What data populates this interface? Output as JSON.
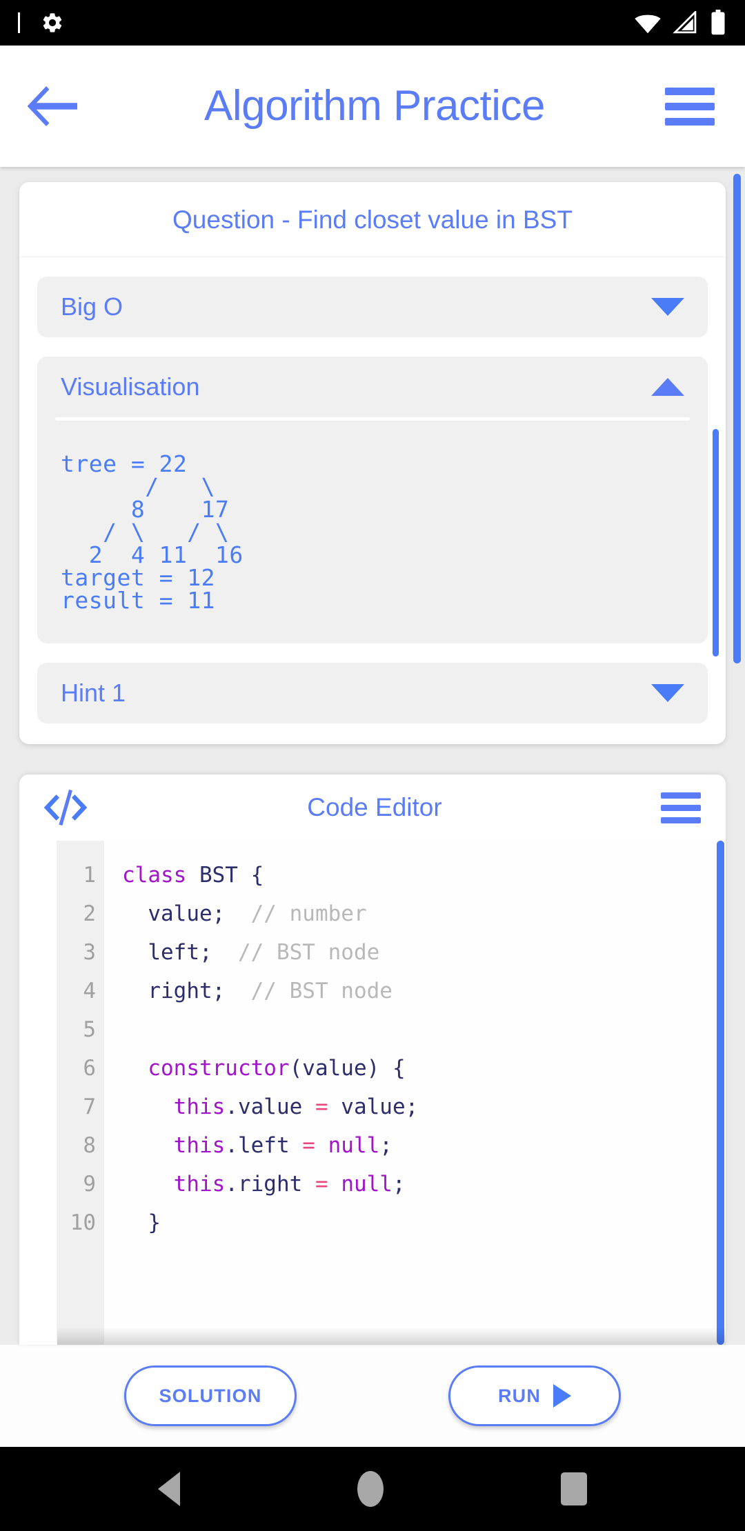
{
  "status_bar": {
    "icons": [
      "text-cursor",
      "gear-icon",
      "wifi-icon",
      "cell-signal-icon",
      "battery-icon"
    ]
  },
  "header": {
    "back_icon": "back-arrow-icon",
    "title": "Algorithm Practice",
    "menu_icon": "hamburger-menu-icon",
    "accent_color": "#5b7cf7"
  },
  "question_card": {
    "title": "Question - Find closet value in BST",
    "accordions": [
      {
        "label": "Big O",
        "expanded": false,
        "chevron": "chevron-down-icon"
      },
      {
        "label": "Visualisation",
        "expanded": true,
        "chevron": "chevron-up-icon"
      },
      {
        "label": "Hint 1",
        "expanded": false,
        "chevron": "chevron-down-icon"
      }
    ],
    "visualisation": {
      "content": "tree = 22\n      /   \\\n     8    17\n   / \\   / \\\n  2  4 11  16\ntarget = 12\nresult = 11",
      "tree_root": 22,
      "target": 12,
      "result": 11
    }
  },
  "code_editor": {
    "icon": "code-brackets-icon",
    "title": "Code Editor",
    "menu_icon": "hamburger-menu-icon",
    "line_numbers": [
      "1",
      "2",
      "3",
      "4",
      "5",
      "6",
      "7",
      "8",
      "9",
      "10"
    ],
    "lines": [
      [
        {
          "t": "class ",
          "c": "key"
        },
        {
          "t": "BST {",
          "c": "pl"
        }
      ],
      [
        {
          "t": "  value;  ",
          "c": "pl"
        },
        {
          "t": "// number",
          "c": "cm"
        }
      ],
      [
        {
          "t": "  left;  ",
          "c": "pl"
        },
        {
          "t": "// BST node",
          "c": "cm"
        }
      ],
      [
        {
          "t": "  right;  ",
          "c": "pl"
        },
        {
          "t": "// BST node",
          "c": "cm"
        }
      ],
      [
        {
          "t": "",
          "c": "pl"
        }
      ],
      [
        {
          "t": "  constructor",
          "c": "key"
        },
        {
          "t": "(value) {",
          "c": "pl"
        }
      ],
      [
        {
          "t": "    this",
          "c": "key"
        },
        {
          "t": ".value ",
          "c": "pl"
        },
        {
          "t": "=",
          "c": "op"
        },
        {
          "t": " value;",
          "c": "pl"
        }
      ],
      [
        {
          "t": "    this",
          "c": "key"
        },
        {
          "t": ".left ",
          "c": "pl"
        },
        {
          "t": "=",
          "c": "op"
        },
        {
          "t": " ",
          "c": "pl"
        },
        {
          "t": "null",
          "c": "key"
        },
        {
          "t": ";",
          "c": "pl"
        }
      ],
      [
        {
          "t": "    this",
          "c": "key"
        },
        {
          "t": ".right ",
          "c": "pl"
        },
        {
          "t": "=",
          "c": "op"
        },
        {
          "t": " ",
          "c": "pl"
        },
        {
          "t": "null",
          "c": "key"
        },
        {
          "t": ";",
          "c": "pl"
        }
      ],
      [
        {
          "t": "  }",
          "c": "pl"
        }
      ]
    ]
  },
  "action_bar": {
    "solution_label": "SOLUTION",
    "run_label": "RUN",
    "run_icon": "play-icon"
  },
  "nav_bar": {
    "back": "nav-back-icon",
    "home": "nav-home-icon",
    "recents": "nav-recents-icon"
  }
}
